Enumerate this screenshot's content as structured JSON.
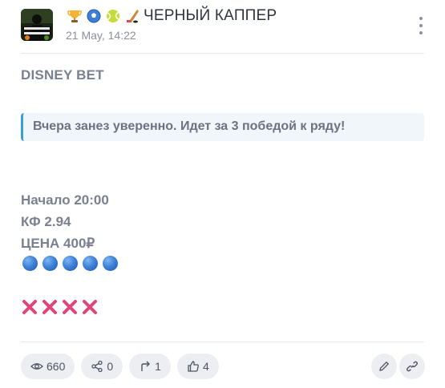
{
  "channel": {
    "name": "ЧЕРНЫЙ КАППЕР",
    "date": "21 May, 14:22",
    "avatar_text": "ЧЕРНЫЙ КАППЕР",
    "title_emojis": [
      "trophy-icon",
      "soccer-ball-icon",
      "tennis-ball-icon",
      "hockey-stick-icon"
    ]
  },
  "post": {
    "brand": "DISNEY BET",
    "quote": "Вчера занез уверенно. Идет за 3 победой к ряду!",
    "start": "Начало 20:00",
    "coef": "КФ 2.94",
    "price": "ЦЕНА 400₽",
    "balls_count": 5,
    "crosses_count": 4
  },
  "stats": {
    "views": "660",
    "shares": "0",
    "forwards": "1",
    "likes": "4"
  },
  "colors": {
    "accent": "#3a9fd2",
    "cross": "#e0457b",
    "ball": "#3f83d9"
  }
}
